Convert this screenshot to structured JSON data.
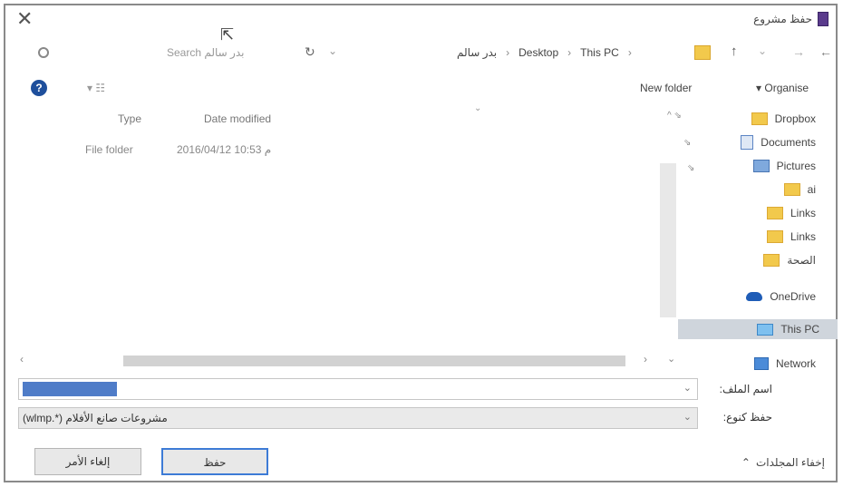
{
  "window": {
    "title": "حفظ مشروع",
    "close_icon": "close-icon"
  },
  "address_bar": {
    "search_placeholder": "Search بدر سالم",
    "breadcrumbs": [
      "This PC",
      "Desktop",
      "بدر سالم"
    ],
    "separator": "›"
  },
  "toolbar": {
    "help_label": "?",
    "new_folder": "New folder",
    "organise": "Organise"
  },
  "file_list": {
    "columns": [
      "Type",
      "Date modified"
    ],
    "rows": [
      {
        "type": "File folder",
        "date": "2016/04/12 م 10:53"
      }
    ]
  },
  "nav_pane": {
    "items": [
      {
        "label": "Dropbox",
        "icon": "folder-icon"
      },
      {
        "label": "Documents",
        "icon": "documents-icon"
      },
      {
        "label": "Pictures",
        "icon": "pictures-icon"
      },
      {
        "label": "ai",
        "icon": "folder-icon"
      },
      {
        "label": "Links",
        "icon": "folder-icon"
      },
      {
        "label": "Links",
        "icon": "folder-icon"
      },
      {
        "label": "الصحة",
        "icon": "folder-icon"
      },
      {
        "label": "OneDrive",
        "icon": "onedrive-icon"
      },
      {
        "label": "This PC",
        "icon": "this-pc-icon",
        "selected": true
      },
      {
        "label": "Network",
        "icon": "network-icon"
      }
    ]
  },
  "fields": {
    "filename_label": "اسم الملف:",
    "filename_value": "",
    "filetype_label": "حفظ كنوع:",
    "filetype_value": "مشروعات صانع الأفلام (*.wlmp)"
  },
  "buttons": {
    "save": "حفظ",
    "cancel": "إلغاء الأمر"
  },
  "hide_folders": "إخفاء المجلدات",
  "colors": {
    "accent": "#3d7bd6",
    "selection": "#4f7cc8",
    "folder": "#f2c94c"
  }
}
